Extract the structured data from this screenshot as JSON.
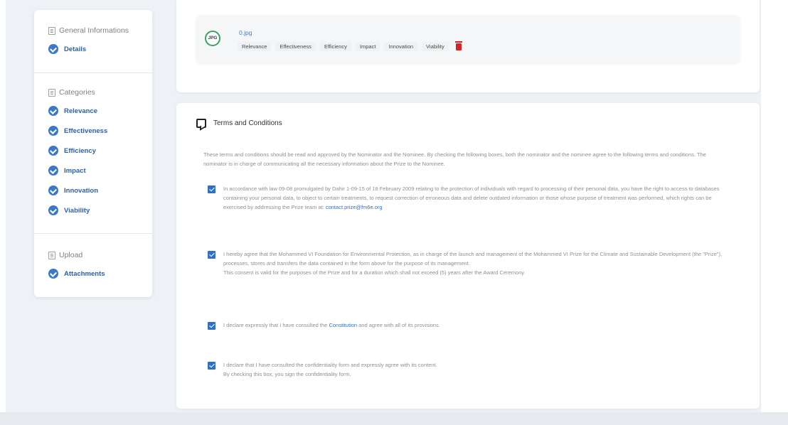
{
  "sidebar": {
    "general_header": "General Informations",
    "general_items": [
      {
        "label": "Details"
      }
    ],
    "categories_header": "Categories",
    "category_items": [
      {
        "label": "Relevance"
      },
      {
        "label": "Effectiveness"
      },
      {
        "label": "Efficiency"
      },
      {
        "label": "Impact"
      },
      {
        "label": "Innovation"
      },
      {
        "label": "Viability"
      }
    ],
    "upload_header": "Upload",
    "upload_items": [
      {
        "label": "Attachments"
      }
    ]
  },
  "attachment": {
    "badge": "JPG",
    "file_name": "0.jpg",
    "tags": [
      "Relevance",
      "Effectiveness",
      "Efficiency",
      "Impact",
      "Innovation",
      "Viability"
    ]
  },
  "terms": {
    "title": "Terms and Conditions",
    "intro": "These terms and conditions should be read and approved by the Nominator and the Nominee. By checking the following boxes, both the nominator and the nominee agree to the following terms and conditions. The nominator is in charge of communicating all the necessary information about the Prize to the Nominee.",
    "items": [
      {
        "text": "In accordance with law 09-08 promulgated by Dahir 1-09-15 of 18 February 2009 relating to the protection of individuals with regard to processing of their personal data, you have the right to access to databases containing your personal data, to object to certain treatments, to request correction of erroneous data and delete outdated information or those whose purpose of treatment was performed, which rights can be exercised by addressing the Prize team at:",
        "link": "contact.prize@fm6e.org",
        "suffix": ""
      },
      {
        "text": "I hereby agree that the Mohammed VI Foundation for Environmental Protection, as in charge of the launch and management of the Mohammed VI Prize for the Climate and Sustainable Development (the \"Prize\"), processes, stores and transfers the data contained in the form above for the purpose of its management.",
        "text2": "This consent is valid for the purposes of the Prize and for a duration which shall not exceed (5) years after the Award Ceremony."
      },
      {
        "text": "I declare expressly that I have consulted the",
        "link": "Constitution",
        "suffix": "and agree with all of its provisions."
      },
      {
        "text": "I declare that I have consulted the confidentiality form and expressly agree with its content.",
        "text2": "By checking this box, you sign the confidentiality form."
      }
    ]
  },
  "colors": {
    "accent": "#2f6fc4",
    "check_circle": "#3a78c9",
    "delete": "#d6242a",
    "jpg_ring": "#3aa35f"
  }
}
